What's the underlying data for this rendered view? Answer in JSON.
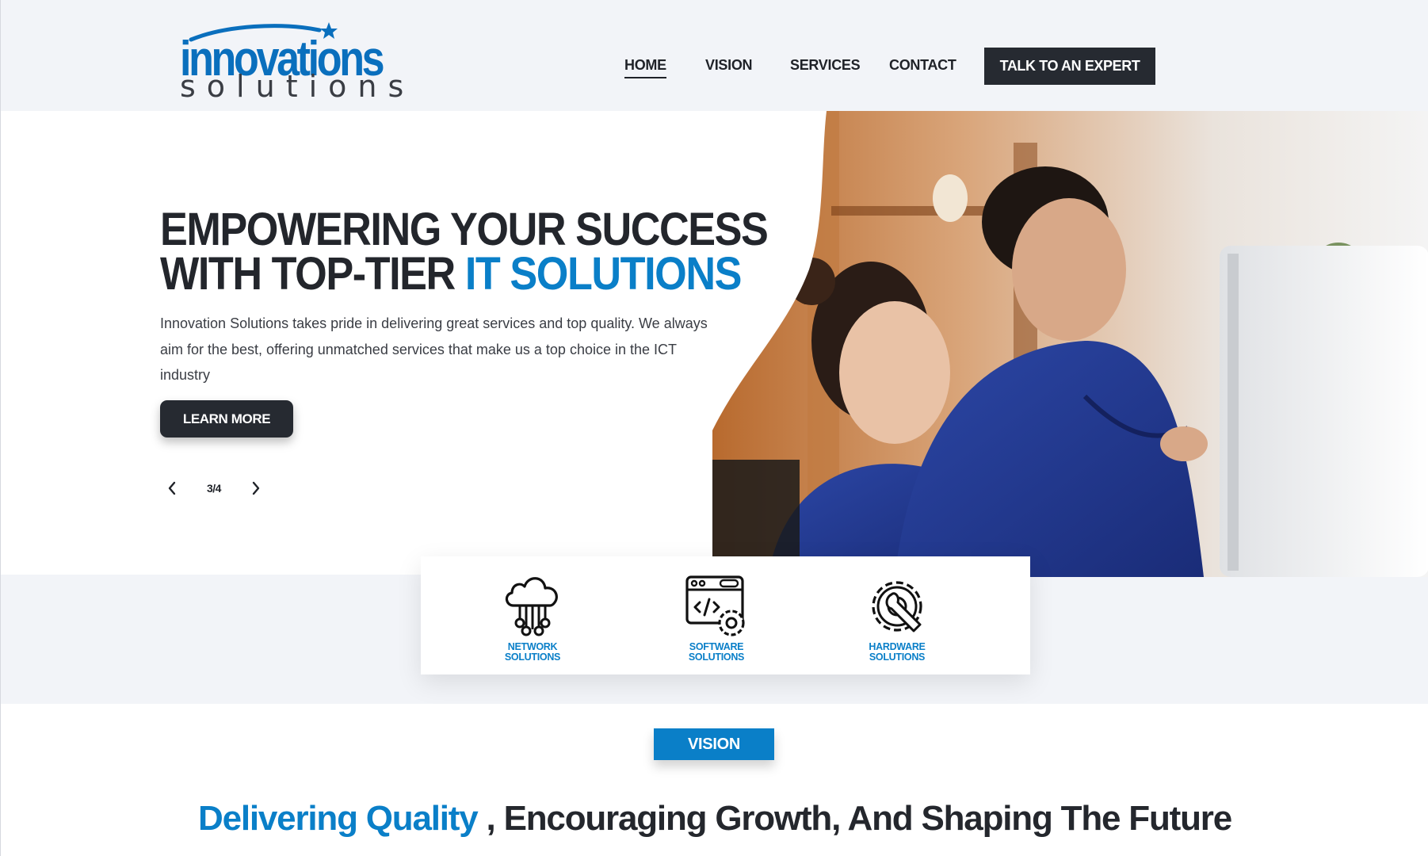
{
  "brand": {
    "name_main": "innovations",
    "name_sub": "solutions",
    "accent_color": "#0a7fc8",
    "dark_color": "#262a31"
  },
  "nav": {
    "home": "HOME",
    "vision": "VISION",
    "services": "SERVICES",
    "contact": "CONTACT",
    "cta": "TALK TO AN EXPERT",
    "active": "HOME"
  },
  "hero": {
    "headline_line1": "EMPOWERING YOUR SUCCESS",
    "headline_line2_prefix": "WITH TOP-TIER ",
    "headline_line2_accent": "IT SOLUTIONS",
    "lead": "Innovation Solutions takes pride in delivering great services and top quality. We always aim for the best, offering unmatched services that make us a top choice in the ICT industry",
    "button": "LEARN MORE",
    "slide_counter": "3/4",
    "prev_icon": "chevron-left-icon",
    "next_icon": "chevron-right-icon"
  },
  "services": [
    {
      "label_line1": "NETWORK",
      "label_line2": "SOLUTIONS",
      "icon": "cloud-network-icon"
    },
    {
      "label_line1": "SOFTWARE",
      "label_line2": "SOLUTIONS",
      "icon": "code-gear-icon"
    },
    {
      "label_line1": "HARDWARE",
      "label_line2": "SOLUTIONS",
      "icon": "gear-wrench-icon"
    }
  ],
  "vision": {
    "tag": "VISION",
    "tagline_highlight": "Delivering Quality",
    "tagline_rest": " , Encouraging Growth, And Shaping The Future"
  }
}
